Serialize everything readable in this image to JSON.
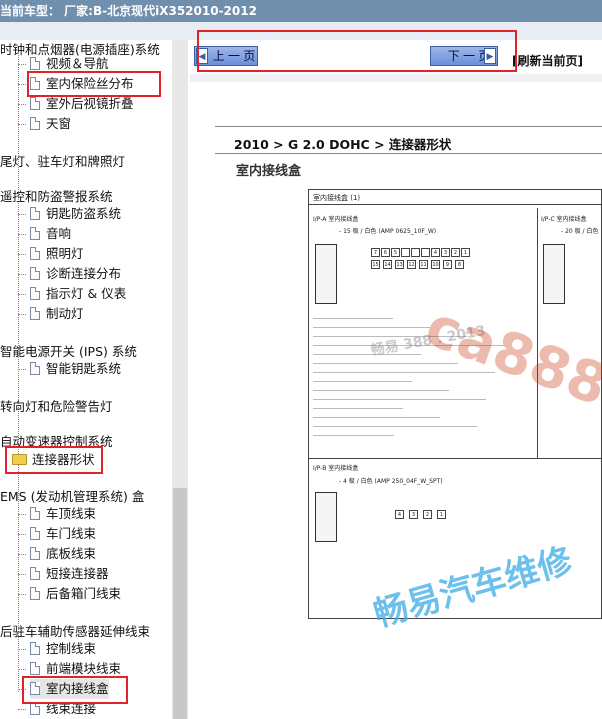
{
  "titlebar": {
    "text": "当前车型： 厂家:B-北京现代iX352010-2012"
  },
  "nav": {
    "prev_label": "上 一 页",
    "next_label": "下 一 页",
    "refresh_label": "[刷新当前页]"
  },
  "tree": {
    "items": [
      {
        "label": "时钟和点烟器(电源插座)系统",
        "type": "group"
      },
      {
        "label": "视频＆导航",
        "type": "doc"
      },
      {
        "label": "室内保险丝分布",
        "type": "doc",
        "highlighted": true
      },
      {
        "label": "室外后视镜折叠",
        "type": "doc"
      },
      {
        "label": "天窗",
        "type": "doc"
      },
      {
        "label": "尾灯、驻车灯和牌照灯",
        "type": "group"
      },
      {
        "label": "遥控和防盗警报系统",
        "type": "group"
      },
      {
        "label": "钥匙防盗系统",
        "type": "doc"
      },
      {
        "label": "音响",
        "type": "doc"
      },
      {
        "label": "照明灯",
        "type": "doc"
      },
      {
        "label": "诊断连接分布",
        "type": "doc"
      },
      {
        "label": "指示灯 & 仪表",
        "type": "doc"
      },
      {
        "label": "制动灯",
        "type": "doc"
      },
      {
        "label": "智能电源开关 (IPS) 系统",
        "type": "group"
      },
      {
        "label": "智能钥匙系统",
        "type": "doc"
      },
      {
        "label": "转向灯和危险警告灯",
        "type": "group"
      },
      {
        "label": "自动变速器控制系统",
        "type": "group"
      },
      {
        "label": "连接器形状",
        "type": "folder",
        "highlighted": true
      },
      {
        "label": "EMS (发动机管理系统) 盒",
        "type": "group"
      },
      {
        "label": "车顶线束",
        "type": "doc"
      },
      {
        "label": "车门线束",
        "type": "doc"
      },
      {
        "label": "底板线束",
        "type": "doc"
      },
      {
        "label": "短接连接器",
        "type": "doc"
      },
      {
        "label": "后备箱门线束",
        "type": "doc"
      },
      {
        "label": "后驻车辅助传感器延伸线束",
        "type": "group"
      },
      {
        "label": "控制线束",
        "type": "doc"
      },
      {
        "label": "前端模块线束",
        "type": "doc"
      },
      {
        "label": "室内接线盒",
        "type": "doc",
        "highlighted": true,
        "selected": true
      },
      {
        "label": "线束连接",
        "type": "doc"
      }
    ]
  },
  "document": {
    "breadcrumb": "2010 > G 2.0 DOHC > 连接器形状",
    "subtitle": "室内接线盒",
    "diagram": {
      "header": "室内接线盒 (1)",
      "panel_a_code": "I/P-A 室内接线盒",
      "panel_a_spec": "- 15 极 / 白色 (AMP 0625_10F_W)",
      "panel_c_code": "I/P-C 室内接线盒",
      "panel_c_spec": "- 20 极 / 白色",
      "panel_b_code": "I/P-B 室内接线盒",
      "panel_b_spec": "- 4 极 / 白色 (AMP 250_04F_W_SPT)",
      "pins_top": [
        "7",
        "6",
        "5",
        "",
        "",
        "",
        "4",
        "3",
        "2",
        "1"
      ],
      "pins_bottom": [
        "15",
        "14",
        "13",
        "12",
        "11",
        "10",
        "9",
        "8"
      ],
      "pins_b": [
        "4",
        "3",
        "2",
        "1"
      ]
    }
  },
  "watermarks": {
    "brand_url": "ca888.cn",
    "brand_text": "畅易汽车维修",
    "small": "畅易 388 . 2013"
  }
}
